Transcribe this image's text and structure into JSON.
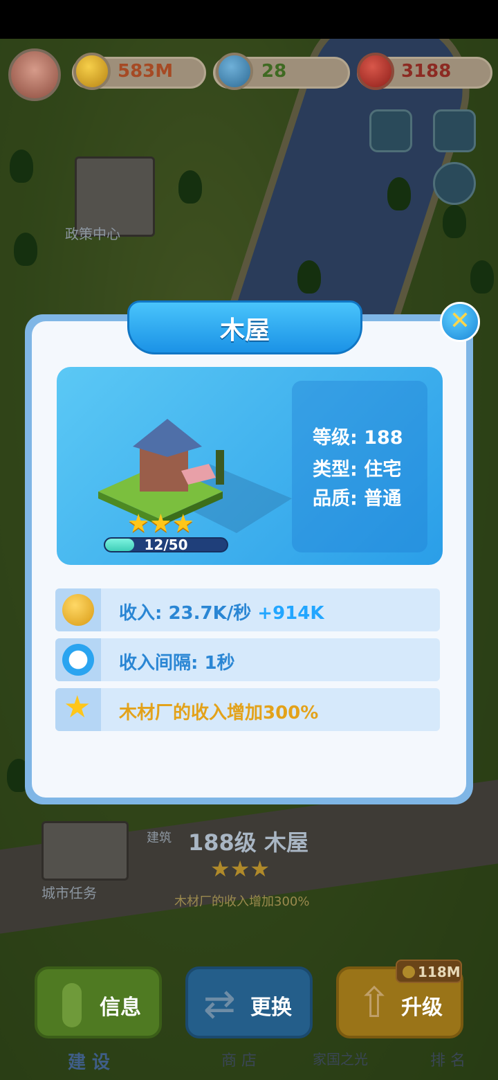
{
  "top_bar": {
    "coins": "583M",
    "stars": "28",
    "hearts": "3188"
  },
  "map_labels": {
    "policy_center": "政策中心",
    "city_task": "城市任务",
    "build_partial": "建筑"
  },
  "dialog": {
    "title": "木屋",
    "close": "✕",
    "info": {
      "level": "等级: 188",
      "type": "类型: 住宅",
      "quality": "品质: 普通"
    },
    "star_count": 3,
    "progress": {
      "text": "12/50",
      "current": 12,
      "max": 50
    },
    "stats": [
      {
        "text": "收入: 23.7K/秒 ",
        "extra": "+914K",
        "icon": "coin-icon"
      },
      {
        "text": "收入间隔: 1秒",
        "extra": "",
        "icon": "clock-icon"
      },
      {
        "text": "木材厂的收入增加300%",
        "extra": "",
        "icon": "star-icon"
      }
    ]
  },
  "background_panel": {
    "title": "188级 木屋",
    "description": "木材厂的收入增加300%"
  },
  "actions": {
    "info": "信息",
    "replace": "更换",
    "upgrade": "升级",
    "upgrade_cost": "118M"
  },
  "bottom_nav": {
    "build": "建 设",
    "shop": "商 店",
    "homeland": "家国之光",
    "rank": "排 名"
  },
  "colors": {
    "accent_blue": "#1b92e6",
    "gold": "#ffc61a",
    "income_green": "#22a6ff"
  }
}
